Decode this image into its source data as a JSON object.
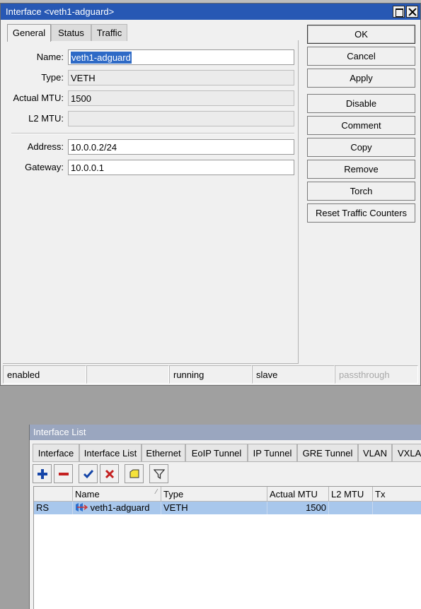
{
  "dialog": {
    "title": "Interface <veth1-adguard>",
    "tabs": [
      "General",
      "Status",
      "Traffic"
    ],
    "fields": {
      "name_label": "Name:",
      "name_value": "veth1-adguard",
      "type_label": "Type:",
      "type_value": "VETH",
      "mtu_label": "Actual MTU:",
      "mtu_value": "1500",
      "l2mtu_label": "L2 MTU:",
      "l2mtu_value": "",
      "address_label": "Address:",
      "address_value": "10.0.0.2/24",
      "gateway_label": "Gateway:",
      "gateway_value": "10.0.0.1"
    },
    "buttons": [
      "OK",
      "Cancel",
      "Apply",
      "Disable",
      "Comment",
      "Copy",
      "Remove",
      "Torch",
      "Reset Traffic Counters"
    ],
    "status": [
      "enabled",
      "",
      "running",
      "slave",
      "passthrough"
    ]
  },
  "list": {
    "title": "Interface List",
    "tabs": [
      "Interface",
      "Interface List",
      "Ethernet",
      "EoIP Tunnel",
      "IP Tunnel",
      "GRE Tunnel",
      "VLAN",
      "VXLA"
    ],
    "toolbar_icons": [
      "add-icon",
      "remove-icon",
      "enable-icon",
      "disable-icon",
      "comment-icon",
      "filter-icon"
    ],
    "columns": [
      "",
      "Name",
      "Type",
      "Actual MTU",
      "L2 MTU",
      "Tx"
    ],
    "rows": [
      {
        "flags": "RS",
        "name": "veth1-adguard",
        "type": "VETH",
        "mtu": "1500",
        "l2mtu": "",
        "tx": ""
      }
    ],
    "colors": {
      "selected_row": "#a8c7ec",
      "title_inactive": "#9aa6bf"
    }
  },
  "colors": {
    "titlebar": "#2758b4",
    "selection": "#2e6ac6"
  }
}
